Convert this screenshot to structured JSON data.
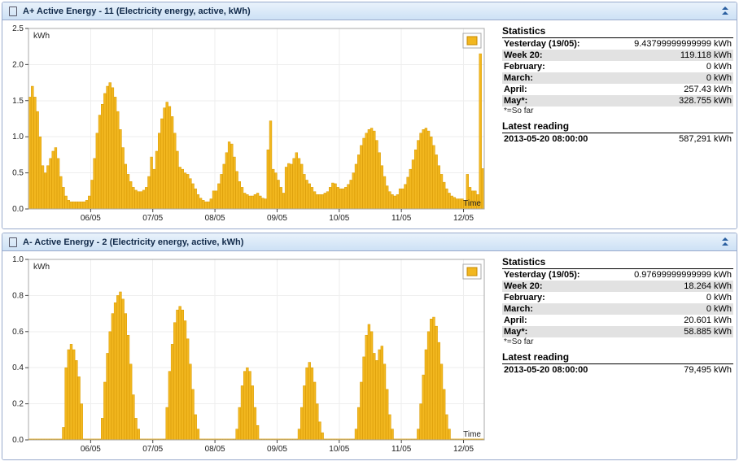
{
  "panels": [
    {
      "title": "A+ Active Energy - 11 (Electricity energy, active, kWh)",
      "chart_key": 0,
      "stats_title": "Statistics",
      "rows": [
        {
          "label": "Yesterday (19/05):",
          "value": "9.43799999999999 kWh",
          "sh": false
        },
        {
          "label": "Week 20:",
          "value": "119.118 kWh",
          "sh": true
        },
        {
          "label": "February:",
          "value": "0 kWh",
          "sh": false
        },
        {
          "label": "March:",
          "value": "0 kWh",
          "sh": true
        },
        {
          "label": "April:",
          "value": "257.43 kWh",
          "sh": false
        },
        {
          "label": "May*:",
          "value": "328.755 kWh",
          "sh": true
        }
      ],
      "note": "*=So far",
      "latest_title": "Latest reading",
      "latest_time": "2013-05-20 08:00:00",
      "latest_value": "587,291 kWh"
    },
    {
      "title": "A- Active Energy - 2 (Electricity energy, active, kWh)",
      "chart_key": 1,
      "stats_title": "Statistics",
      "rows": [
        {
          "label": "Yesterday (19/05):",
          "value": "0.97699999999999 kWh",
          "sh": false
        },
        {
          "label": "Week 20:",
          "value": "18.264 kWh",
          "sh": true
        },
        {
          "label": "February:",
          "value": "0 kWh",
          "sh": false
        },
        {
          "label": "March:",
          "value": "0 kWh",
          "sh": true
        },
        {
          "label": "April:",
          "value": "20.601 kWh",
          "sh": false
        },
        {
          "label": "May*:",
          "value": "58.885 kWh",
          "sh": true
        }
      ],
      "note": "*=So far",
      "latest_title": "Latest reading",
      "latest_time": "2013-05-20 08:00:00",
      "latest_value": "79,495 kWh"
    }
  ],
  "chart_data": [
    {
      "type": "bar",
      "title": "",
      "xlabel": "Time",
      "ylabel": "kWh",
      "ylim": [
        0,
        2.5
      ],
      "yticks": [
        0.0,
        0.5,
        1.0,
        1.5,
        2.0,
        2.5
      ],
      "x_tick_labels": [
        "06/05",
        "07/05",
        "08/05",
        "09/05",
        "10/05",
        "11/05",
        "12/05"
      ],
      "x_tick_positions": [
        24,
        48,
        72,
        96,
        120,
        144,
        168
      ],
      "categories_count": 176,
      "values": [
        1.55,
        1.7,
        1.55,
        1.35,
        1.0,
        0.6,
        0.5,
        0.6,
        0.7,
        0.8,
        0.85,
        0.7,
        0.45,
        0.3,
        0.18,
        0.12,
        0.1,
        0.1,
        0.1,
        0.1,
        0.1,
        0.1,
        0.12,
        0.18,
        0.4,
        0.7,
        1.05,
        1.3,
        1.45,
        1.6,
        1.7,
        1.75,
        1.68,
        1.55,
        1.35,
        1.1,
        0.85,
        0.62,
        0.48,
        0.38,
        0.3,
        0.26,
        0.24,
        0.24,
        0.26,
        0.3,
        0.45,
        0.72,
        0.55,
        0.8,
        1.05,
        1.25,
        1.4,
        1.48,
        1.42,
        1.28,
        1.05,
        0.8,
        0.58,
        0.55,
        0.5,
        0.48,
        0.42,
        0.35,
        0.28,
        0.2,
        0.15,
        0.12,
        0.1,
        0.1,
        0.14,
        0.25,
        0.25,
        0.35,
        0.48,
        0.62,
        0.78,
        0.93,
        0.9,
        0.72,
        0.52,
        0.38,
        0.3,
        0.22,
        0.2,
        0.18,
        0.18,
        0.2,
        0.22,
        0.18,
        0.15,
        0.14,
        0.82,
        1.22,
        0.55,
        0.5,
        0.4,
        0.3,
        0.22,
        0.58,
        0.63,
        0.62,
        0.7,
        0.78,
        0.7,
        0.62,
        0.48,
        0.4,
        0.35,
        0.3,
        0.24,
        0.2,
        0.2,
        0.2,
        0.22,
        0.24,
        0.3,
        0.36,
        0.35,
        0.3,
        0.28,
        0.28,
        0.3,
        0.34,
        0.4,
        0.5,
        0.62,
        0.75,
        0.88,
        0.98,
        1.05,
        1.1,
        1.12,
        1.08,
        0.95,
        0.78,
        0.6,
        0.45,
        0.32,
        0.24,
        0.2,
        0.18,
        0.2,
        0.28,
        0.28,
        0.34,
        0.44,
        0.55,
        0.68,
        0.82,
        0.95,
        1.05,
        1.1,
        1.12,
        1.08,
        1.0,
        0.88,
        0.75,
        0.6,
        0.48,
        0.37,
        0.28,
        0.22,
        0.18,
        0.16,
        0.14,
        0.14,
        0.14,
        0.12,
        0.48,
        0.3,
        0.25,
        0.25,
        0.2,
        2.15,
        0.56
      ]
    },
    {
      "type": "bar",
      "title": "",
      "xlabel": "Time",
      "ylabel": "kWh",
      "ylim": [
        0,
        1.0
      ],
      "yticks": [
        0.0,
        0.2,
        0.4,
        0.6,
        0.8,
        1.0
      ],
      "x_tick_labels": [
        "06/05",
        "07/05",
        "08/05",
        "09/05",
        "10/05",
        "11/05",
        "12/05"
      ],
      "x_tick_positions": [
        24,
        48,
        72,
        96,
        120,
        144,
        168
      ],
      "categories_count": 176,
      "values": [
        0.005,
        0.005,
        0.005,
        0.005,
        0.005,
        0.005,
        0.005,
        0.005,
        0.005,
        0.005,
        0.005,
        0.005,
        0.005,
        0.07,
        0.4,
        0.5,
        0.53,
        0.5,
        0.44,
        0.35,
        0.2,
        0.005,
        0.005,
        0.005,
        0.005,
        0.005,
        0.005,
        0.005,
        0.12,
        0.32,
        0.48,
        0.6,
        0.7,
        0.76,
        0.8,
        0.82,
        0.78,
        0.7,
        0.58,
        0.42,
        0.25,
        0.12,
        0.06,
        0.005,
        0.005,
        0.005,
        0.005,
        0.005,
        0.005,
        0.005,
        0.005,
        0.005,
        0.005,
        0.18,
        0.38,
        0.53,
        0.65,
        0.72,
        0.74,
        0.72,
        0.66,
        0.56,
        0.42,
        0.28,
        0.14,
        0.06,
        0.005,
        0.005,
        0.005,
        0.005,
        0.005,
        0.005,
        0.005,
        0.005,
        0.005,
        0.005,
        0.005,
        0.005,
        0.005,
        0.005,
        0.06,
        0.18,
        0.3,
        0.38,
        0.4,
        0.38,
        0.3,
        0.18,
        0.08,
        0.005,
        0.005,
        0.005,
        0.005,
        0.005,
        0.005,
        0.005,
        0.005,
        0.005,
        0.005,
        0.005,
        0.005,
        0.005,
        0.005,
        0.005,
        0.06,
        0.18,
        0.3,
        0.4,
        0.43,
        0.4,
        0.32,
        0.2,
        0.1,
        0.04,
        0.005,
        0.005,
        0.005,
        0.005,
        0.005,
        0.005,
        0.005,
        0.005,
        0.005,
        0.005,
        0.005,
        0.005,
        0.06,
        0.18,
        0.32,
        0.46,
        0.58,
        0.64,
        0.6,
        0.48,
        0.44,
        0.5,
        0.52,
        0.42,
        0.28,
        0.14,
        0.06,
        0.005,
        0.005,
        0.005,
        0.005,
        0.005,
        0.005,
        0.005,
        0.005,
        0.005,
        0.06,
        0.2,
        0.36,
        0.5,
        0.6,
        0.67,
        0.68,
        0.63,
        0.54,
        0.42,
        0.28,
        0.14,
        0.06,
        0.005,
        0.005,
        0.005,
        0.005,
        0.005,
        0.005,
        0.005,
        0.005,
        0.005,
        0.005,
        0.005,
        0.005,
        0.005
      ]
    }
  ]
}
